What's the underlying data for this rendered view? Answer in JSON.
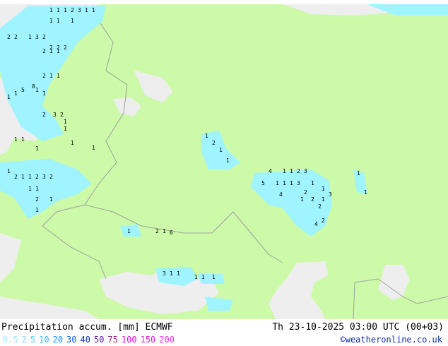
{
  "map": {
    "colors": {
      "land": "#ccfaa8",
      "sea": "#eeeeee",
      "precip_light": "#a0f4ff",
      "precip_mid": "#70d8f8",
      "border": "#a0a0a0"
    },
    "labels": [
      "1",
      "1",
      "1",
      "2",
      "3",
      "1",
      "1",
      "1",
      "1",
      "1",
      "2",
      "2",
      "1",
      "2",
      "3",
      "2",
      "1",
      "1",
      "2",
      "2",
      "2",
      "2",
      "1",
      "1",
      "1",
      "1",
      "5",
      "8",
      "1",
      "1",
      "2",
      "3",
      "2",
      "1",
      "1",
      "1",
      "1",
      "1",
      "1",
      "1",
      "1",
      "2",
      "1",
      "1",
      "2",
      "3",
      "2",
      "1",
      "1",
      "2",
      "1",
      "1",
      "1",
      "2",
      "1",
      "1",
      "4",
      "1",
      "1",
      "2",
      "3",
      "5",
      "1",
      "1",
      "1",
      "3",
      "2",
      "1",
      "1",
      "3",
      "4",
      "1",
      "2",
      "1",
      "2",
      "4",
      "2",
      "1",
      "1",
      "1",
      "2",
      "1",
      "6",
      "3",
      "1",
      "1",
      "1",
      "1",
      "1"
    ]
  },
  "footer": {
    "title": "Precipitation accum. [mm] ECMWF",
    "datetime": "Th 23-10-2025 03:00 UTC (00+03)",
    "credit": "©weatheronline.co.uk",
    "legend": [
      {
        "value": "0.5",
        "color": "#a0e8ff"
      },
      {
        "value": "2",
        "color": "#80dcff"
      },
      {
        "value": "5",
        "color": "#60ccff"
      },
      {
        "value": "10",
        "color": "#40b8ff"
      },
      {
        "value": "20",
        "color": "#2090ff"
      },
      {
        "value": "30",
        "color": "#1060e0"
      },
      {
        "value": "40",
        "color": "#1030c0"
      },
      {
        "value": "50",
        "color": "#6020a0"
      },
      {
        "value": "75",
        "color": "#a02090"
      },
      {
        "value": "100",
        "color": "#e010d0"
      },
      {
        "value": "150",
        "color": "#e020e0"
      },
      {
        "value": "200",
        "color": "#f030f0"
      }
    ]
  }
}
